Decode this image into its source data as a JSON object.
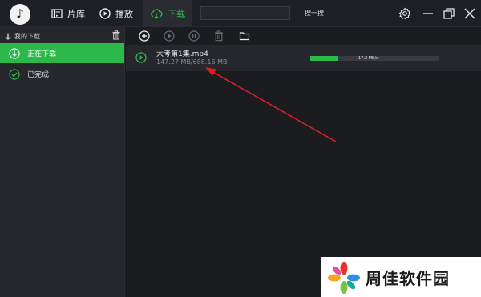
{
  "app": {
    "logo_glyph": "♪",
    "colors": {
      "accent": "#2db84c",
      "background": "#1b1c20",
      "panel": "#26272c",
      "annotation_arrow": "#d41f1f"
    }
  },
  "nav": {
    "library_label": "片库",
    "play_label": "播放",
    "download_label": "下载",
    "search_button": "搜一搜",
    "search_value": ""
  },
  "window_controls": {
    "icons": [
      "gear-icon",
      "minimize-icon",
      "restore-icon",
      "close-icon"
    ]
  },
  "sidebar": {
    "header": "我的下载",
    "items": [
      {
        "label": "正在下载",
        "icon": "download-circle-icon",
        "active": true
      },
      {
        "label": "已完成",
        "icon": "check-circle-icon",
        "active": false
      }
    ]
  },
  "toolbar": {
    "icons": [
      "add-icon",
      "start-icon",
      "pause-icon",
      "delete-icon",
      "folder-icon"
    ]
  },
  "downloads": [
    {
      "name": "大考第1集.mp4",
      "size": "147.27 MB/688.16 MB",
      "speed": "17.2 MB/s",
      "progress": 0.21
    }
  ],
  "watermark": {
    "text": "周佳软件园"
  }
}
